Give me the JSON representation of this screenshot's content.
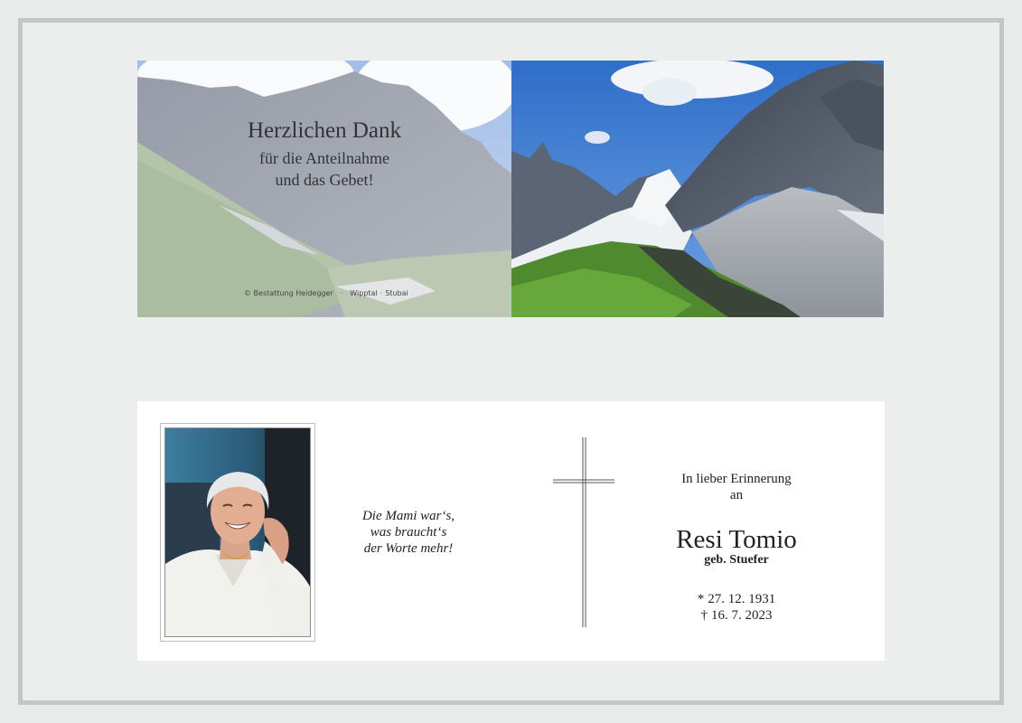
{
  "colors": {
    "page_background": "#e9ebea",
    "frame_border": "#c4c6c6",
    "card_background": "#ffffff",
    "text": "#222222",
    "sky": "#3f79c9"
  },
  "thank_you_card": {
    "title": "Herzlichen Dank",
    "line1": "für die Anteilnahme",
    "line2": "und das Gebet!",
    "copyright": "© Bestattung Heidegger",
    "region1": "Wipptal",
    "region2": "Stubai",
    "image": "alpine-mountain-landscape"
  },
  "memorial_card": {
    "photo": "portrait-smiling-woman",
    "quote": [
      "Die Mami war‘s,",
      "was braucht‘s",
      "der Worte mehr!"
    ],
    "symbol": "cross-icon",
    "remembrance": [
      "In lieber Erinnerung",
      "an"
    ],
    "name": "Resi Tomio",
    "maiden_name": "geb. Stuefer",
    "birth_symbol": "*",
    "birth_date": "27. 12. 1931",
    "death_symbol": "†",
    "death_date": "16. 7. 2023"
  }
}
